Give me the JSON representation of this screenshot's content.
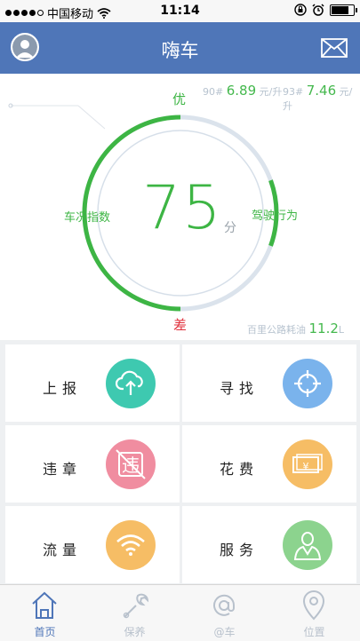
{
  "status": {
    "carrier": "中国移动",
    "time": "11:14"
  },
  "header": {
    "title": "嗨车"
  },
  "fuel": {
    "p90_label": "90#",
    "p90_price": "6.89",
    "p90_unit": "元/升",
    "p93_label": "93#",
    "p93_price": "7.46",
    "p93_unit": "元/升"
  },
  "gauge": {
    "score": "75",
    "score_unit": "分",
    "top_label": "优",
    "bottom_label": "差",
    "left_label": "车况指数",
    "right_label": "驾驶行为",
    "score_fraction": 0.75
  },
  "consumption": {
    "label": "百里公路耗油",
    "value": "11.2",
    "unit": "L"
  },
  "tiles": [
    {
      "label": "上报",
      "icon": "cloud-upload-icon",
      "color": "#3ec9b0"
    },
    {
      "label": "寻找",
      "icon": "crosshair-icon",
      "color": "#7ab3ec"
    },
    {
      "label": "违章",
      "icon": "violation-icon",
      "color": "#f08da0"
    },
    {
      "label": "花费",
      "icon": "money-icon",
      "color": "#f6bd65"
    },
    {
      "label": "流量",
      "icon": "wifi-icon",
      "color": "#f6bd65"
    },
    {
      "label": "服务",
      "icon": "service-person-icon",
      "color": "#8cd38e"
    }
  ],
  "tabs": [
    {
      "label": "首页",
      "icon": "home-icon"
    },
    {
      "label": "保养",
      "icon": "wrench-icon"
    },
    {
      "label": "@车",
      "icon": "at-icon"
    },
    {
      "label": "位置",
      "icon": "location-pin-icon"
    }
  ],
  "colors": {
    "nav": "#4f76b8",
    "gauge_green": "#3db544",
    "gauge_track": "#dbe3ec",
    "danger": "#e0303c"
  }
}
